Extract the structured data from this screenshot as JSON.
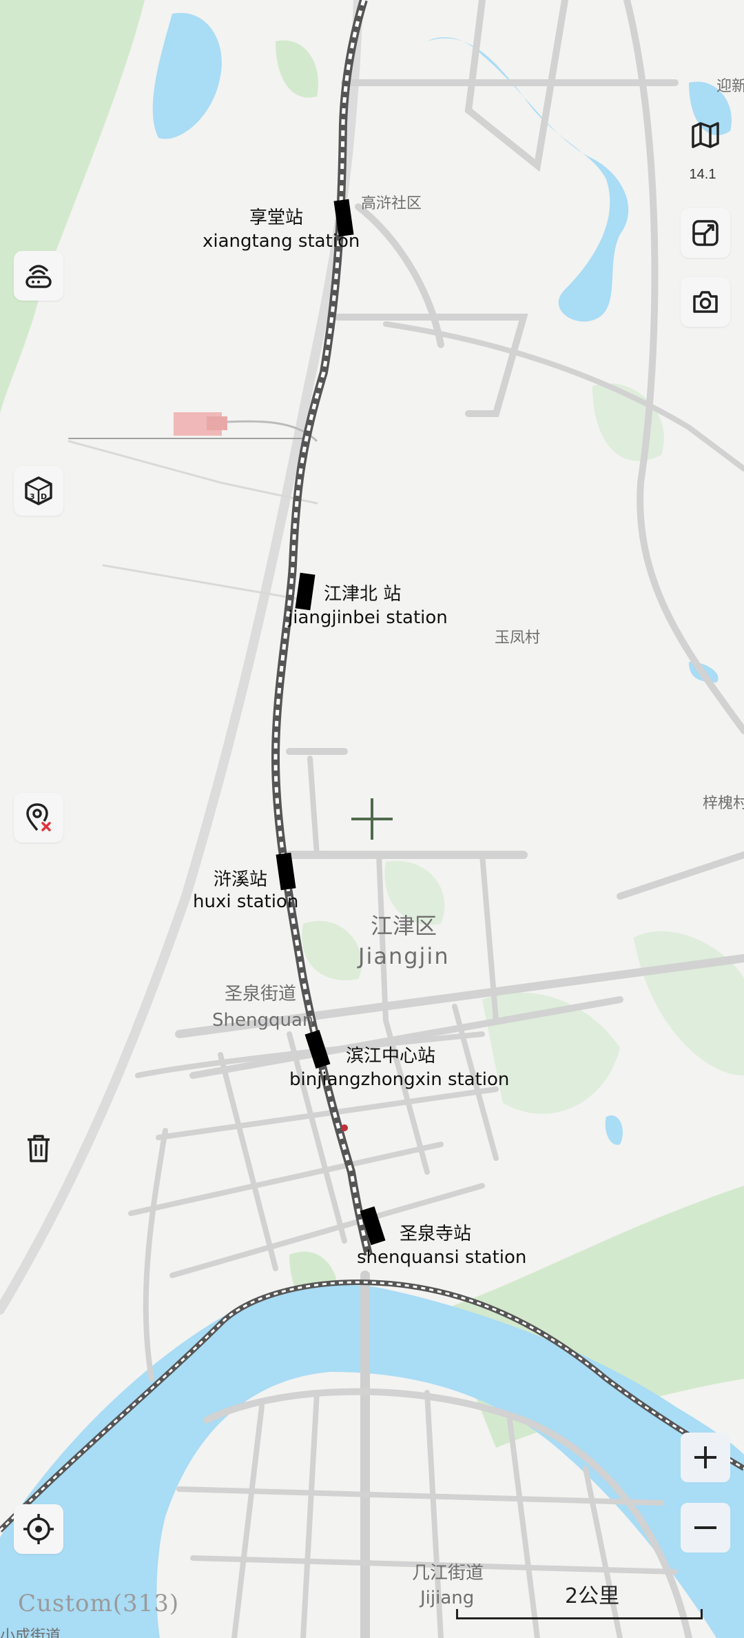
{
  "map": {
    "district": {
      "zh": "江津区",
      "en": "Jiangjin"
    },
    "shengquan": {
      "zh": "圣泉街道",
      "en": "Shengquan"
    },
    "jijiang": {
      "zh": "几江街道",
      "en": "Jijiang"
    },
    "places": {
      "gaojin": "高浒社区",
      "yufeng": "玉凤村",
      "zihe": "梓槐村",
      "yingxin": "迎新",
      "bottom_left": "小成街道"
    },
    "stations": [
      {
        "zh": "享堂站",
        "en": "xiangtang station"
      },
      {
        "zh": "江津北 站",
        "en": "jiangjinbei station"
      },
      {
        "zh": "浒溪站",
        "en": "huxi station"
      },
      {
        "zh": "滨江中心站",
        "en": "binjiangzhongxin station"
      },
      {
        "zh": "圣泉寺站",
        "en": "shenquansi station"
      }
    ]
  },
  "controls": {
    "zoom_level": "14.1",
    "custom_label": "Custom(313)",
    "scale_label": "2公里",
    "icons": {
      "map_layers": "map-icon",
      "fold": "fold-icon",
      "camera": "camera-icon",
      "router": "router-icon",
      "view_3d": "3d-icon",
      "remove_pin": "remove-pin-icon",
      "trash": "trash-icon",
      "locate": "locate-icon",
      "zoom_in": "plus-icon",
      "zoom_out": "minus-icon"
    }
  },
  "colors": {
    "water": "#a9dcf5",
    "green": "#cfe8c9",
    "road": "#d2d2d2",
    "rail_station": "#000000",
    "land": "#f3f3f1"
  }
}
